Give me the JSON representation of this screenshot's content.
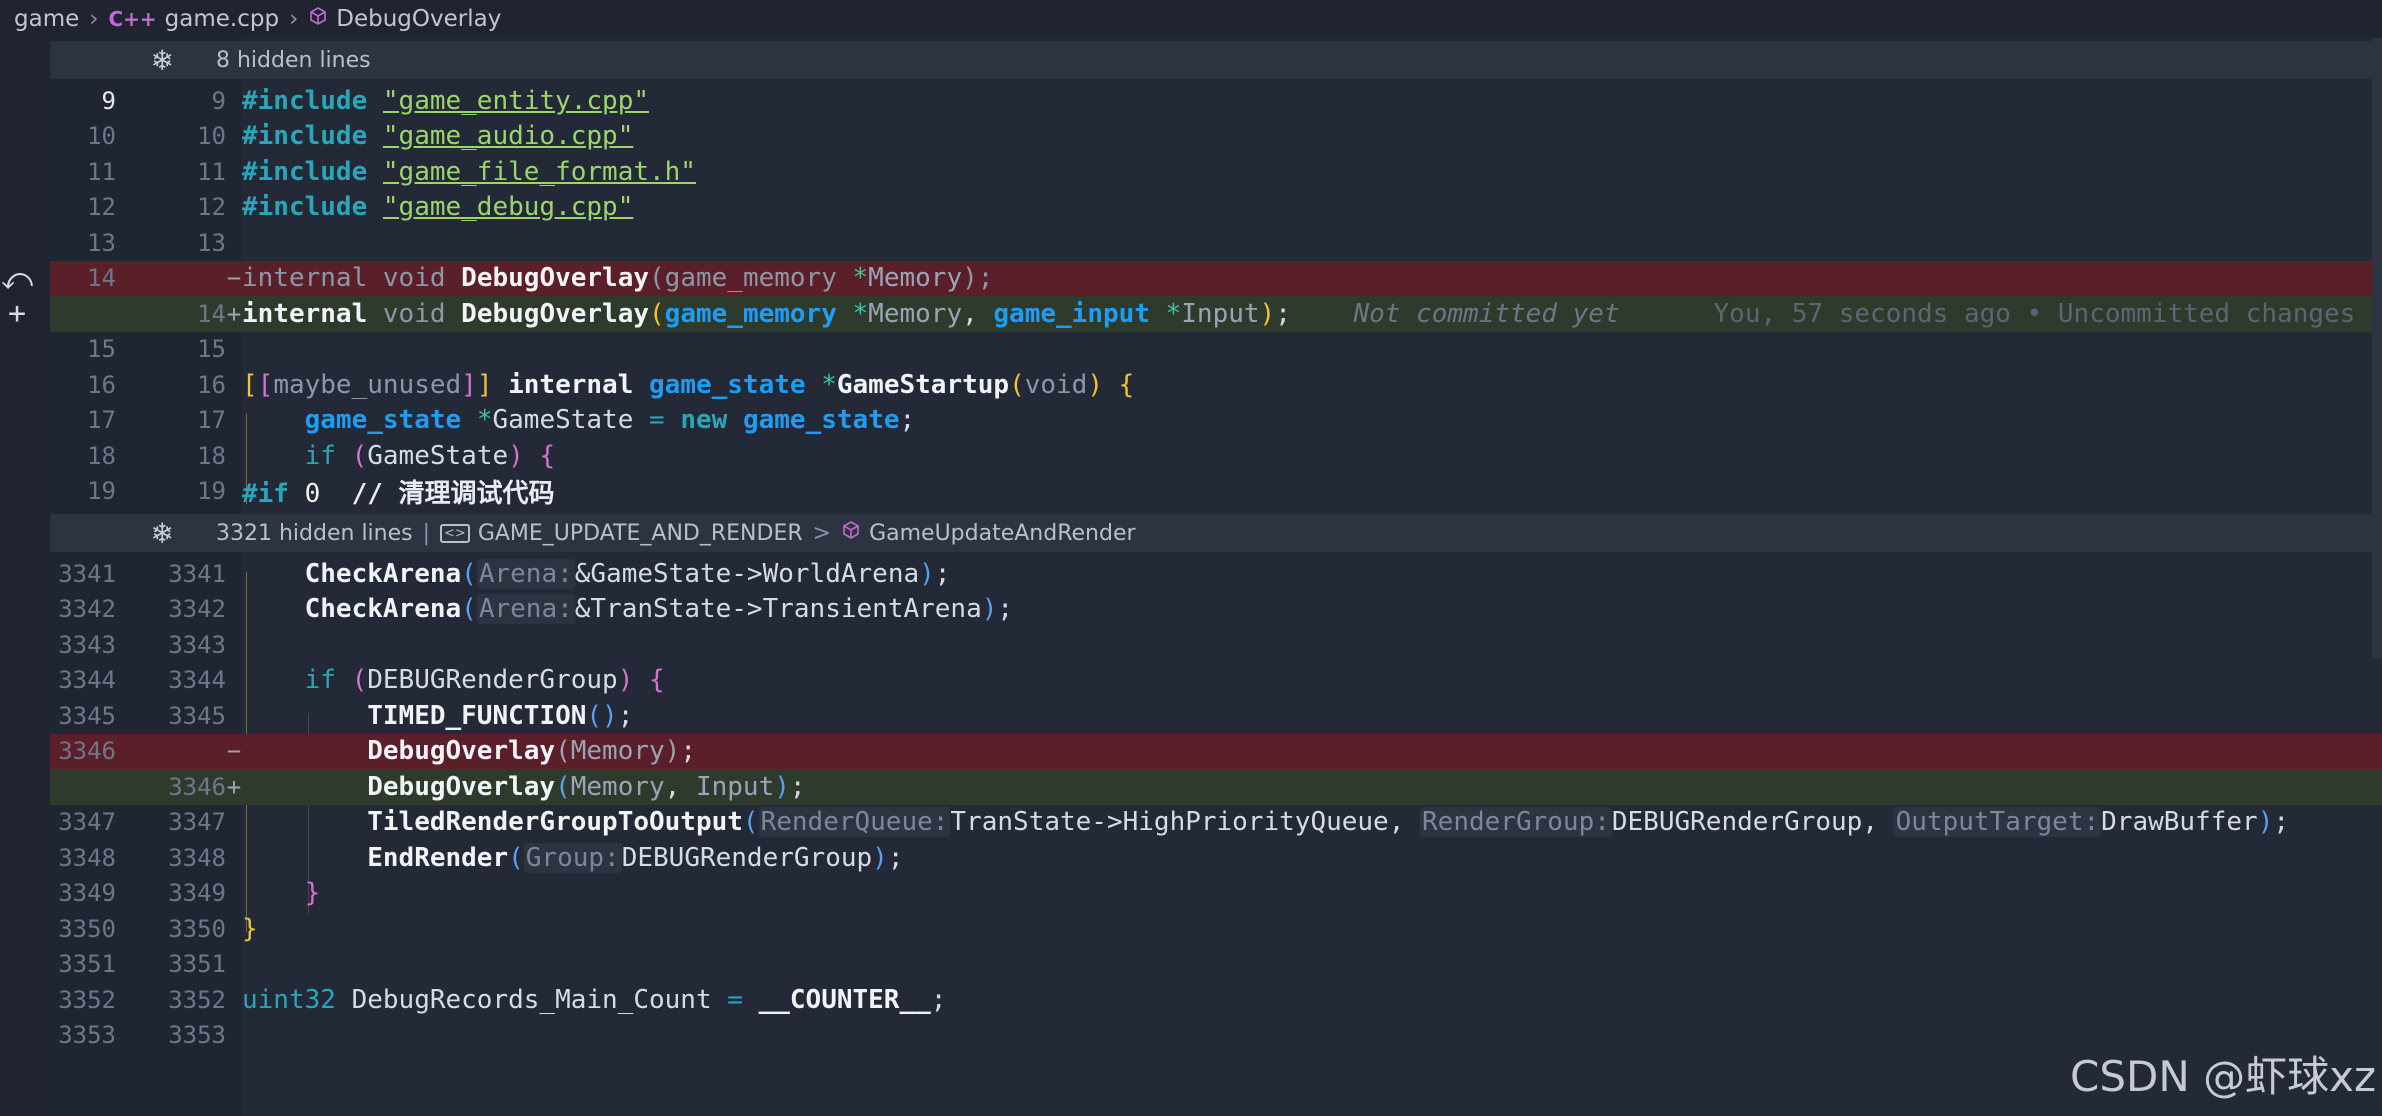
{
  "breadcrumb": {
    "root": "game",
    "file_icon": "C++",
    "file": "game.cpp",
    "symbol_icon": "symbol-icon",
    "symbol": "DebugOverlay"
  },
  "folds": [
    {
      "text": "8 hidden lines"
    },
    {
      "text": "3321 hidden lines",
      "sep": "|",
      "macro_icon": "macro-icon",
      "macro": "GAME_UPDATE_AND_RENDER",
      "arrow": ">",
      "symbol": "GameUpdateAndRender"
    }
  ],
  "lines": [
    {
      "old": "9",
      "new": "9",
      "marker": ""
    },
    {
      "old": "10",
      "new": "10",
      "marker": ""
    },
    {
      "old": "11",
      "new": "11",
      "marker": ""
    },
    {
      "old": "12",
      "new": "12",
      "marker": ""
    },
    {
      "old": "13",
      "new": "13",
      "marker": ""
    },
    {
      "old": "14",
      "new": "",
      "marker": "−"
    },
    {
      "old": "",
      "new": "14",
      "marker": "+"
    },
    {
      "old": "15",
      "new": "15",
      "marker": ""
    },
    {
      "old": "16",
      "new": "16",
      "marker": ""
    },
    {
      "old": "17",
      "new": "17",
      "marker": ""
    },
    {
      "old": "18",
      "new": "18",
      "marker": ""
    },
    {
      "old": "19",
      "new": "19",
      "marker": ""
    },
    {
      "old": "3341",
      "new": "3341",
      "marker": ""
    },
    {
      "old": "3342",
      "new": "3342",
      "marker": ""
    },
    {
      "old": "3343",
      "new": "3343",
      "marker": ""
    },
    {
      "old": "3344",
      "new": "3344",
      "marker": ""
    },
    {
      "old": "3345",
      "new": "3345",
      "marker": ""
    },
    {
      "old": "3346",
      "new": "",
      "marker": "−"
    },
    {
      "old": "",
      "new": "3346",
      "marker": "+"
    },
    {
      "old": "3347",
      "new": "3347",
      "marker": ""
    },
    {
      "old": "3348",
      "new": "3348",
      "marker": ""
    },
    {
      "old": "3349",
      "new": "3349",
      "marker": ""
    },
    {
      "old": "3350",
      "new": "3350",
      "marker": ""
    },
    {
      "old": "3351",
      "new": "3351",
      "marker": ""
    },
    {
      "old": "3352",
      "new": "3352",
      "marker": ""
    },
    {
      "old": "3353",
      "new": "3353",
      "marker": ""
    }
  ],
  "code": {
    "l9_dir": "#include",
    "l9_str": "\"game_entity.cpp\"",
    "l10_dir": "#include",
    "l10_str": "\"game_audio.cpp\"",
    "l11_dir": "#include",
    "l11_str": "\"game_file_format.h\"",
    "l12_dir": "#include",
    "l12_str": "\"game_debug.cpp\"",
    "internal": "internal",
    "void": "void",
    "debug_overlay": "DebugOverlay",
    "game_memory": "game_memory",
    "star": "*",
    "memory": "Memory",
    "game_input": "game_input",
    "input": "Input",
    "blame_msg": "Not committed yet",
    "blame_detail": "You, 57 seconds ago • Uncommitted changes",
    "maybe_unused": "maybe_unused",
    "game_state": "game_state",
    "game_startup": "GameStartup",
    "void_param": "void",
    "gamestate_var": "GameState",
    "new_kw": "new",
    "if_kw": "if",
    "if_pp": "#if",
    "zero": "0",
    "comment": "// 清理调试代码",
    "check_arena": "CheckArena",
    "hint_arena": "Arena:",
    "world_arena": "&GameState->WorldArena",
    "transient_arena": "&TranState->TransientArena",
    "debug_render_group": "DEBUGRenderGroup",
    "timed_function": "TIMED_FUNCTION",
    "tiled_render": "TiledRenderGroupToOutput",
    "hint_render_queue": "RenderQueue:",
    "high_priority": "TranState->HighPriorityQueue",
    "hint_render_group": "RenderGroup:",
    "hint_output_target": "OutputTarget:",
    "draw_buffer": "DrawBuffer",
    "end_render": "EndRender",
    "hint_group": "Group:",
    "uint32": "uint32",
    "debug_records": "DebugRecords_Main_Count",
    "counter": "__COUNTER__"
  },
  "watermark": "CSDN @虾球xz"
}
